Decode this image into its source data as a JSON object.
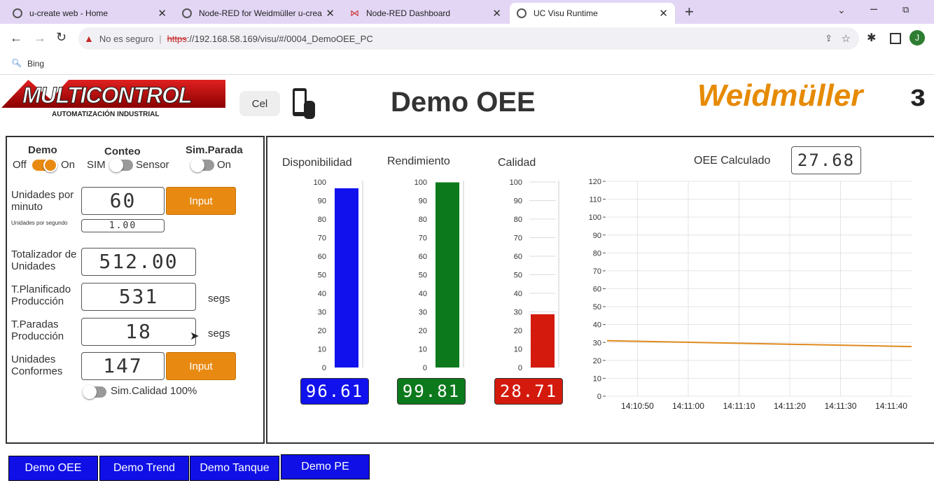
{
  "browser": {
    "tabs": [
      {
        "title": "u-create web - Home"
      },
      {
        "title": "Node-RED for Weidmüller u-crea"
      },
      {
        "title": "Node-RED Dashboard"
      },
      {
        "title": "UC Visu Runtime"
      }
    ],
    "security_label": "No es seguro",
    "url_struck": "https",
    "url_rest": "://192.168.58.169/visu/#/0004_DemoOEE_PC",
    "bookmark": "Bing",
    "profile_initial": "J"
  },
  "header": {
    "logo_text": "MULTICONTROL",
    "logo_sub": "AUTOMATIZACIÓN INDUSTRIAL",
    "cel_label": "Cel",
    "title": "Demo OEE",
    "brand": "Weidmüller"
  },
  "controls": {
    "demo_label": "Demo",
    "demo_off": "Off",
    "demo_on": "On",
    "conteo_label": "Conteo",
    "conteo_sim": "SIM",
    "conteo_sensor": "Sensor",
    "simparada_label": "Sim.Parada",
    "simparada_on": "On",
    "upm_label": "Unidades por minuto",
    "upm_value": "60",
    "input_label": "Input",
    "ups_label": "Unidades por segundo",
    "ups_value": "1.00",
    "total_label": "Totalizador de Unidades",
    "total_value": "512.00",
    "tplan_label": "T.Planificado Producción",
    "tplan_value": "531",
    "segs": "segs",
    "tparadas_label": "T.Paradas Producción",
    "tparadas_value": "18",
    "conformes_label": "Unidades Conformes",
    "conformes_value": "147",
    "simcalidad_label": "Sim.Calidad 100%"
  },
  "gauges": {
    "disponibilidad": {
      "title": "Disponibilidad",
      "value": 96.61,
      "display": "96.61",
      "color": "#1111ee"
    },
    "rendimiento": {
      "title": "Rendimiento",
      "value": 99.81,
      "display": "99.81",
      "color": "#0c7a1c"
    },
    "calidad": {
      "title": "Calidad",
      "value": 28.71,
      "display": "28.71",
      "color": "#d41a0c"
    },
    "ticks": [
      "100",
      "90",
      "80",
      "70",
      "60",
      "50",
      "40",
      "30",
      "20",
      "10",
      "0"
    ]
  },
  "oee": {
    "label": "OEE Calculado",
    "value": "27.68"
  },
  "chart_data": {
    "type": "line",
    "x": [
      "14:10:44",
      "14:11:44"
    ],
    "series": [
      {
        "values": [
          31,
          27.7
        ],
        "color": "#e08a1e"
      }
    ],
    "x_ticks": [
      "14:10:50",
      "14:11:00",
      "14:11:10",
      "14:11:20",
      "14:11:30",
      "14:11:40"
    ],
    "y_ticks": [
      "120",
      "110",
      "100",
      "90",
      "80",
      "70",
      "60",
      "50",
      "40",
      "30",
      "20",
      "10",
      "0"
    ],
    "ylim": [
      0,
      120
    ],
    "grid": true
  },
  "nav": [
    "Demo OEE",
    "Demo Trend",
    "Demo Tanque",
    "Demo PE"
  ]
}
